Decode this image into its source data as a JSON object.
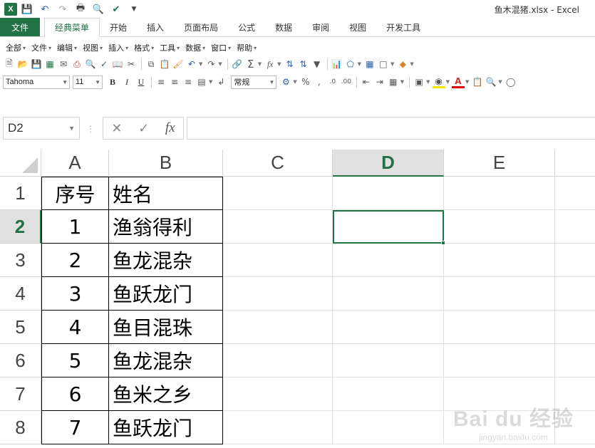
{
  "window": {
    "title": "鱼木混猪.xlsx - Excel"
  },
  "qat": {
    "undo_icon": "undo-icon",
    "redo_icon": "redo-icon"
  },
  "tabs": [
    "文件",
    "经典菜单",
    "开始",
    "插入",
    "页面布局",
    "公式",
    "数据",
    "审阅",
    "视图",
    "开发工具"
  ],
  "active_tab": "经典菜单",
  "menus": [
    "全部",
    "文件",
    "编辑",
    "视图",
    "插入",
    "格式",
    "工具",
    "数据",
    "窗口",
    "帮助"
  ],
  "toolbar": {
    "font_name": "Tahoma",
    "font_size": "11",
    "bold": "B",
    "italic": "I",
    "underline": "U",
    "number_format": "常规",
    "percent": "%",
    "sum": "Σ",
    "fx": "fx"
  },
  "formula_bar": {
    "name_box": "D2",
    "value": ""
  },
  "columns": [
    {
      "label": "A",
      "selected": false
    },
    {
      "label": "B",
      "selected": false
    },
    {
      "label": "C",
      "selected": false
    },
    {
      "label": "D",
      "selected": true
    },
    {
      "label": "E",
      "selected": false
    }
  ],
  "rows": [
    {
      "num": "1",
      "a": "序号",
      "b": "姓名",
      "selected": false
    },
    {
      "num": "2",
      "a": "1",
      "b": "渔翁得利",
      "selected": true
    },
    {
      "num": "3",
      "a": "2",
      "b": "鱼龙混杂",
      "selected": false
    },
    {
      "num": "4",
      "a": "3",
      "b": "鱼跃龙门",
      "selected": false
    },
    {
      "num": "5",
      "a": "4",
      "b": "鱼目混珠",
      "selected": false
    },
    {
      "num": "6",
      "a": "5",
      "b": "鱼龙混杂",
      "selected": false
    },
    {
      "num": "7",
      "a": "6",
      "b": "鱼米之乡",
      "selected": false
    },
    {
      "num": "8",
      "a": "7",
      "b": "鱼跃龙门",
      "selected": false
    }
  ],
  "active_cell": "D2",
  "watermark": {
    "brand": "Bai du 经验",
    "url": "jingyan.baidu.com"
  },
  "colors": {
    "accent": "#217346",
    "selection_header": "#e1e1e1"
  }
}
